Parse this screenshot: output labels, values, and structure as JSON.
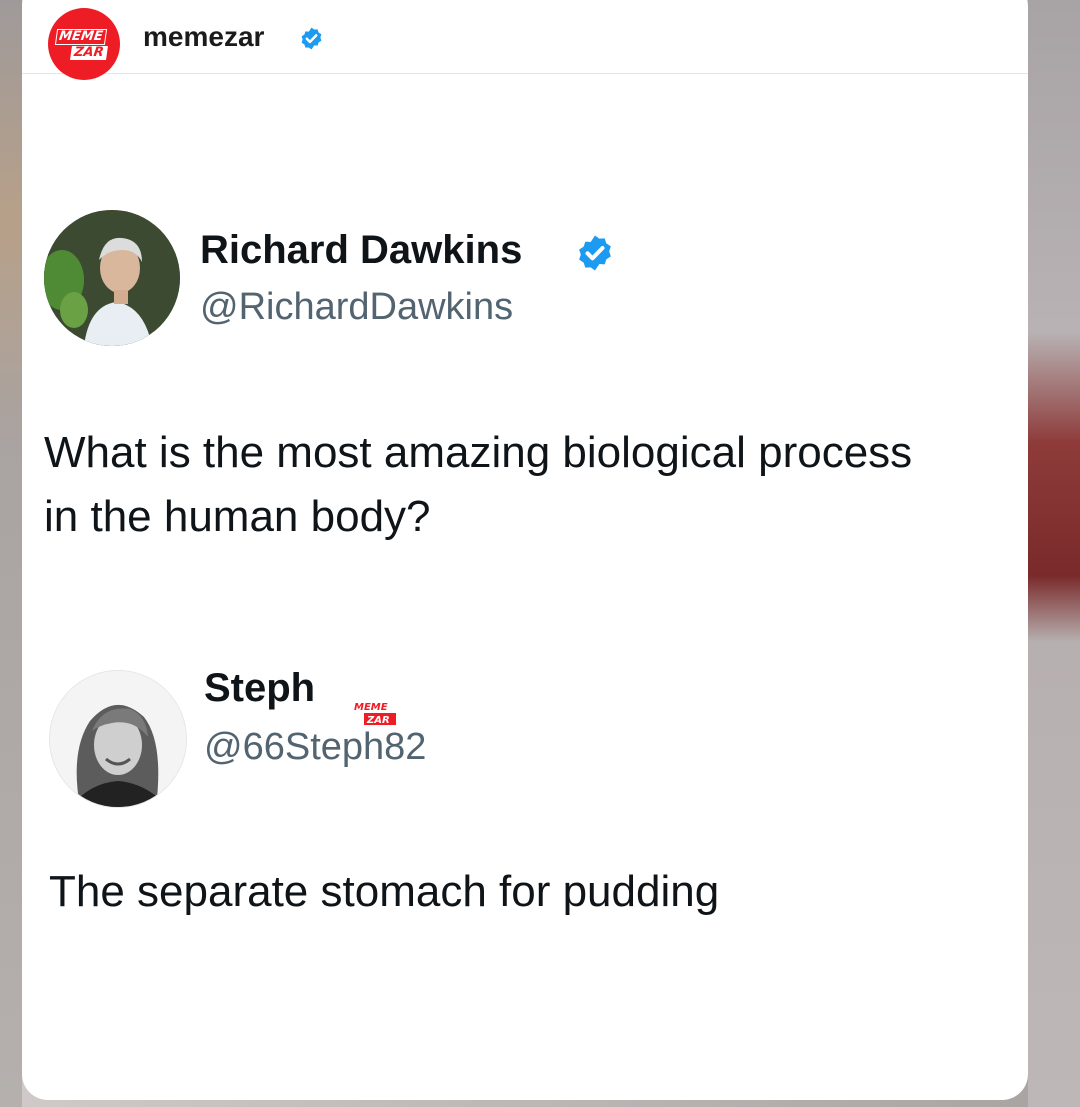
{
  "post": {
    "account_name": "memezar",
    "logo_text_top": "MEME",
    "logo_text_bottom": "ZAR",
    "verified_color": "#1d9bf0",
    "brand_color": "#ee1c24"
  },
  "tweet": {
    "author_name": "Richard Dawkins",
    "author_handle": "@RichardDawkins",
    "text": "What is the most amazing biological process in the human body?"
  },
  "reply": {
    "author_name": "Steph",
    "author_handle": "@66Steph82",
    "watermark_top": "MEME",
    "watermark_bottom": "ZAR",
    "text": "The separate stomach for pudding"
  }
}
